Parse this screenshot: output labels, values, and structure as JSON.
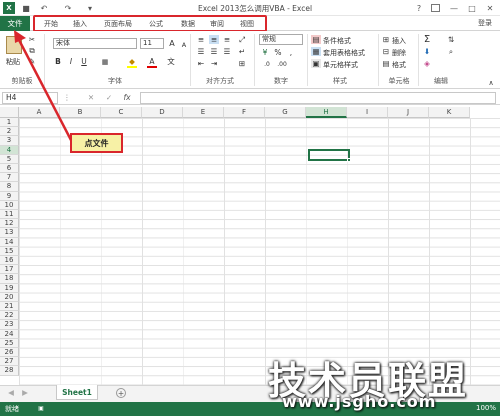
{
  "window": {
    "title": "Excel 2013怎么调用VBA - Excel",
    "help": "?",
    "restore_icon": "ribbon-display-icon",
    "minimize": "—",
    "maximize": "□",
    "close": "✕",
    "login": "登录"
  },
  "qat": {
    "undo": "↶",
    "redo": "↷",
    "save": "■",
    "more": "▾"
  },
  "tabs": {
    "file": "文件",
    "items": [
      "开始",
      "插入",
      "页面布局",
      "公式",
      "数据",
      "审阅",
      "视图"
    ]
  },
  "ribbon": {
    "clipboard": {
      "paste": "粘贴",
      "label": "剪贴板"
    },
    "font": {
      "name": "宋体",
      "size": "11",
      "bold": "B",
      "italic": "I",
      "underline": "U",
      "grow": "A",
      "shrink": "A",
      "wen": "文",
      "color_a": "A",
      "label": "字体"
    },
    "alignment": {
      "label": "对齐方式"
    },
    "number": {
      "format": "常规",
      "label": "数字",
      "percent": "%",
      "comma": ","
    },
    "styles": {
      "conditional": "条件格式",
      "table": "套用表格格式",
      "cell": "单元格样式",
      "label": "样式"
    },
    "cells": {
      "insert": "插入",
      "delete": "删除",
      "format": "格式",
      "label": "单元格"
    },
    "editing": {
      "sum": "Σ",
      "label": "编辑"
    }
  },
  "formula_bar": {
    "name_box": "H4",
    "cancel": "✕",
    "enter": "✓",
    "fx": "fx"
  },
  "columns": [
    "A",
    "B",
    "C",
    "D",
    "E",
    "F",
    "G",
    "H",
    "I",
    "J",
    "K"
  ],
  "rows": [
    "1",
    "2",
    "3",
    "4",
    "5",
    "6",
    "7",
    "8",
    "9",
    "10",
    "11",
    "12",
    "13",
    "14",
    "15",
    "16",
    "17",
    "18",
    "19",
    "20",
    "21",
    "22",
    "23",
    "24",
    "25",
    "26",
    "27",
    "28"
  ],
  "callout": "点文件",
  "sheet_tabs": {
    "active": "Sheet1",
    "add": "+",
    "prev": "◀",
    "next": "▶"
  },
  "status": {
    "ready": "就绪",
    "zoom": "100%"
  },
  "watermark": {
    "brand": "技术员联盟",
    "url": "www.jsgho.com"
  },
  "colors": {
    "excel_green": "#217346",
    "highlight_red": "#d9262c",
    "callout_fill": "#f7f1a6"
  }
}
